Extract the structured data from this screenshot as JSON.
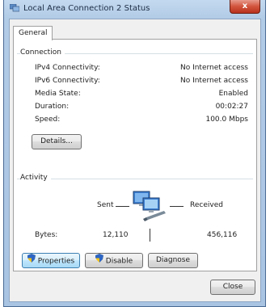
{
  "window": {
    "title": "Local Area Connection 2 Status",
    "close_glyph": "x"
  },
  "tabs": [
    {
      "label": "General"
    }
  ],
  "connection": {
    "group_label": "Connection",
    "rows": [
      {
        "label": "IPv4 Connectivity:",
        "value": "No Internet access"
      },
      {
        "label": "IPv6 Connectivity:",
        "value": "No Internet access"
      },
      {
        "label": "Media State:",
        "value": "Enabled"
      },
      {
        "label": "Duration:",
        "value": "00:02:27"
      },
      {
        "label": "Speed:",
        "value": "100.0 Mbps"
      }
    ],
    "details_button": "Details..."
  },
  "activity": {
    "group_label": "Activity",
    "sent_label": "Sent",
    "received_label": "Received",
    "bytes_label": "Bytes:",
    "bytes_sent": "12,110",
    "bytes_received": "456,116",
    "icon": "network-computers-icon"
  },
  "buttons": {
    "properties": "Properties",
    "disable": "Disable",
    "diagnose": "Diagnose",
    "close": "Close"
  },
  "colors": {
    "title_bar": "#b2cbe6",
    "close_button": "#d2543c",
    "panel_bg": "#ffffff"
  }
}
